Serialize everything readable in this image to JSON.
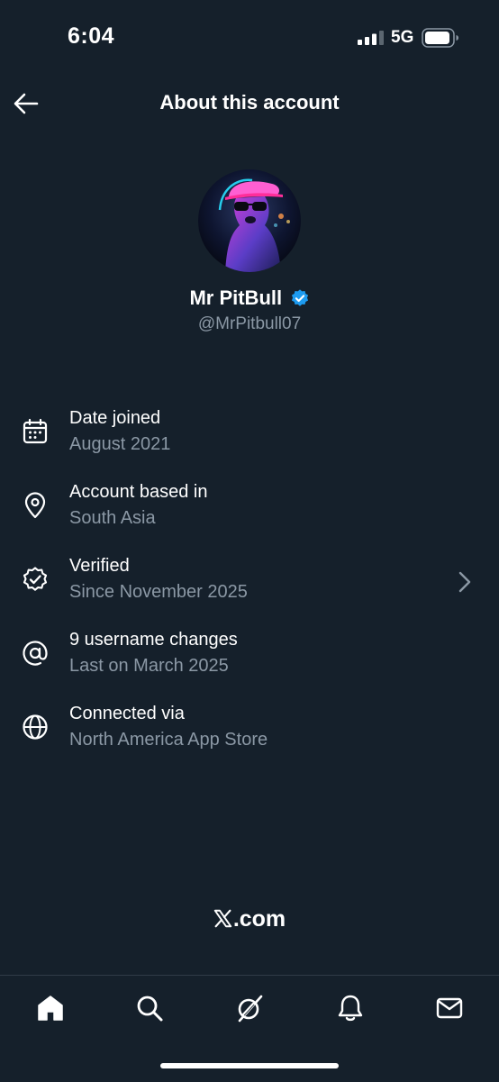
{
  "status_bar": {
    "time": "6:04",
    "network": "5G"
  },
  "header": {
    "title": "About this account"
  },
  "profile": {
    "name": "Mr PitBull",
    "handle": "@MrPitbull07",
    "verified": true
  },
  "info_items": [
    {
      "icon": "calendar-icon",
      "label": "Date joined",
      "value": "August 2021"
    },
    {
      "icon": "location-pin-icon",
      "label": "Account based in",
      "value": "South Asia"
    },
    {
      "icon": "verified-check-icon",
      "label": "Verified",
      "value": "Since November 2025",
      "has_chevron": true
    },
    {
      "icon": "at-sign-icon",
      "label": "9 username changes",
      "value": "Last on March 2025"
    },
    {
      "icon": "globe-icon",
      "label": "Connected via",
      "value": "North America App Store"
    }
  ],
  "footer": {
    "brand_suffix": ".com"
  },
  "tab_bar": {
    "tabs": [
      "home-icon",
      "search-icon",
      "grok-icon",
      "notifications-bell-icon",
      "messages-envelope-icon"
    ]
  },
  "colors": {
    "background": "#15202b",
    "secondary_text": "#8b98a5",
    "verified_blue": "#1d9bf0"
  }
}
